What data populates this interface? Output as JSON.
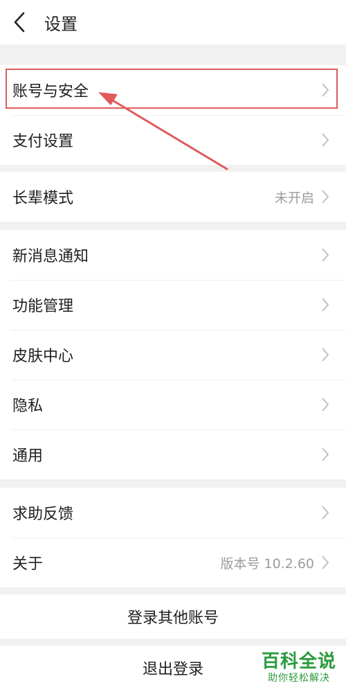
{
  "header": {
    "title": "设置",
    "back_icon": "chevron-left-icon"
  },
  "groups": [
    {
      "rows": [
        {
          "label": "账号与安全"
        },
        {
          "label": "支付设置"
        }
      ]
    },
    {
      "rows": [
        {
          "label": "长辈模式",
          "value": "未开启"
        }
      ]
    },
    {
      "rows": [
        {
          "label": "新消息通知"
        },
        {
          "label": "功能管理"
        },
        {
          "label": "皮肤中心"
        },
        {
          "label": "隐私"
        },
        {
          "label": "通用"
        }
      ]
    },
    {
      "rows": [
        {
          "label": "求助反馈"
        },
        {
          "label": "关于",
          "value": "版本号 10.2.60"
        }
      ]
    }
  ],
  "actions": {
    "switch_account": "登录其他账号",
    "logout": "退出登录"
  },
  "annotation": {
    "color": "#e05a5a"
  },
  "watermark": {
    "title": "百科全说",
    "subtitle": "助你轻松解决",
    "color": "#2a9a3c"
  }
}
